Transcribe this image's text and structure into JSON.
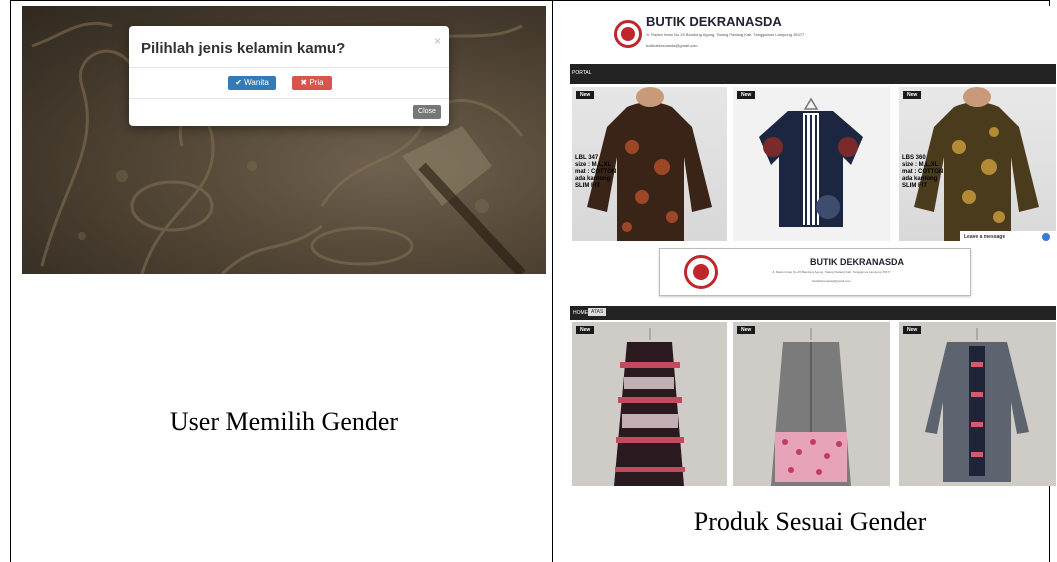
{
  "left": {
    "modal": {
      "title": "Pilihlah jenis kelamin kamu?",
      "close_x": "×",
      "wanita_label": "✔ Wanita",
      "pria_label": "✖ Pria",
      "close_label": "Close"
    },
    "caption": "User Memilih Gender"
  },
  "right": {
    "header": {
      "shop_name": "BUTIK DEKRANASDA",
      "address": "Jl. Raden Intan No.25 Bandung Agung, Talang Padang Kab. Tanggamus Lampung 35377",
      "email": "butikdekranasda@gmail.com"
    },
    "nav": {
      "label": "PORTAL"
    },
    "products_top": [
      {
        "tag": "New",
        "desc": "LBL 347\nsize : M,L,XL\nmat : COTTON\nada kantong\nSLIM FIT"
      },
      {
        "tag": "New",
        "desc": ""
      },
      {
        "tag": "New",
        "desc": "LBS 360\nsize : M,L,XL\nmat : COTTON\nada kantong\nSLIM FIT"
      }
    ],
    "leave_message": "Leave a message",
    "banner": {
      "name": "BUTIK DEKRANASDA",
      "address": "Jl. Raden Intan No.25 Bandung Agung, Talang Padang Kab. Tanggamus Lampung 35377",
      "email": "butikdekranasda@gmail.com"
    },
    "nav2": {
      "home": "HOME",
      "tag": "ATAS"
    },
    "products_bottom": [
      {
        "tag": "New"
      },
      {
        "tag": "New"
      },
      {
        "tag": "New"
      }
    ],
    "caption": "Produk Sesuai Gender"
  },
  "colors": {
    "wanita_button": "#337ab7",
    "pria_button": "#d9534f",
    "logo_red": "#c0272d",
    "navbar": "#222222"
  }
}
